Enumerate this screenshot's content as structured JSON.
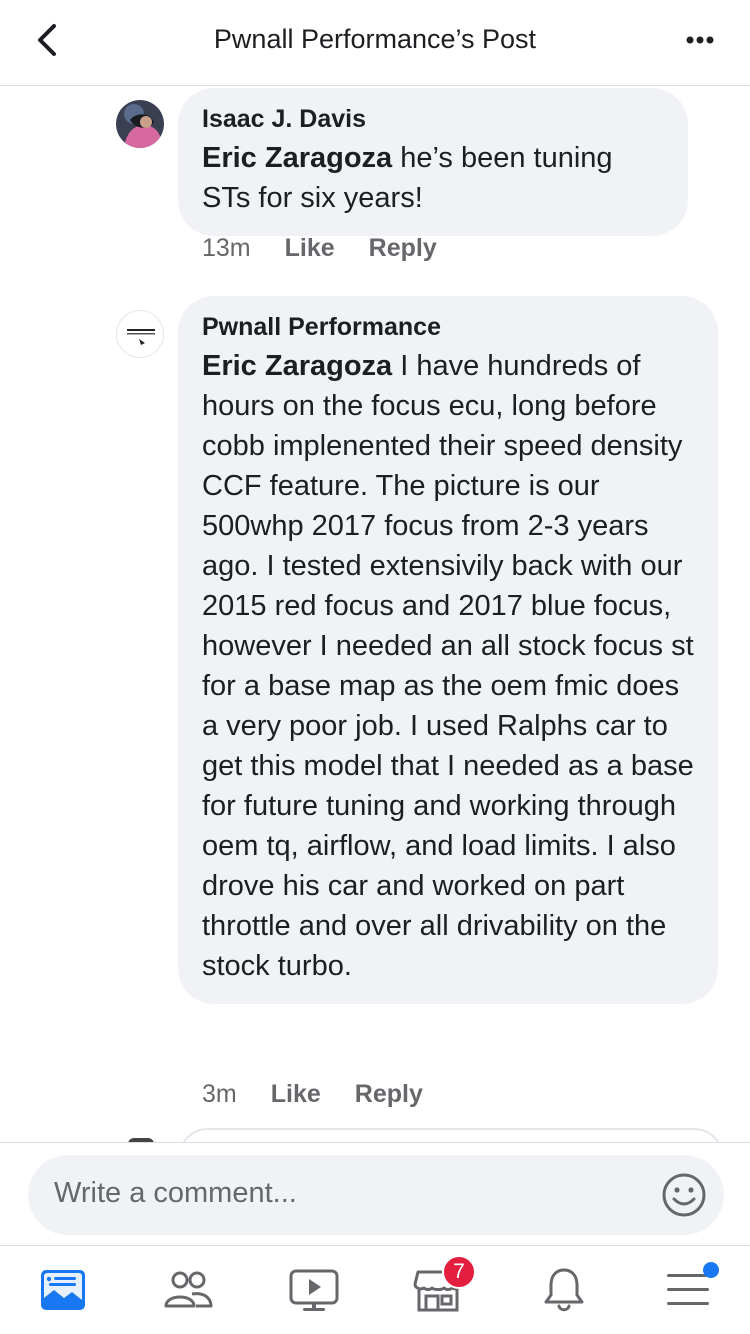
{
  "header": {
    "title": "Pwnall Performance’s Post"
  },
  "comments": [
    {
      "author": "Isaac J. Davis",
      "mention": "Eric Zaragoza",
      "body": "  he’s been tuning STs for six years!",
      "time": "13m",
      "like_label": "Like",
      "reply_label": "Reply"
    },
    {
      "author": "Pwnall Performance",
      "avatar_text": "PWNALL PERFORMANCE",
      "mention": "Eric Zaragoza",
      "body": " I have hundreds of hours on the focus ecu, long before cobb implenented their speed density CCF feature.  The picture is our 500whp 2017 focus from 2-3 years ago.  I tested extensivily back with our 2015 red focus and 2017 blue focus, however I needed an all stock focus st for a base map as the oem fmic does a very poor job.  I used Ralphs car to get this  model that I needed as a base for future tuning and working through oem tq, airflow, and load limits.  I also drove his car and worked on part throttle and over all drivability on the stock turbo.",
      "time": "3m",
      "like_label": "Like",
      "reply_label": "Reply"
    }
  ],
  "composer": {
    "placeholder": "Write a comment..."
  },
  "tabbar": {
    "items": [
      "news-feed-icon",
      "friends-icon",
      "watch-icon",
      "marketplace-icon",
      "notifications-icon",
      "menu-icon"
    ],
    "marketplace_badge": "7"
  },
  "colors": {
    "bubble": "#f0f2f5",
    "accent": "#1877f2",
    "badge": "#e41e3f",
    "secondary_text": "#65676b"
  }
}
